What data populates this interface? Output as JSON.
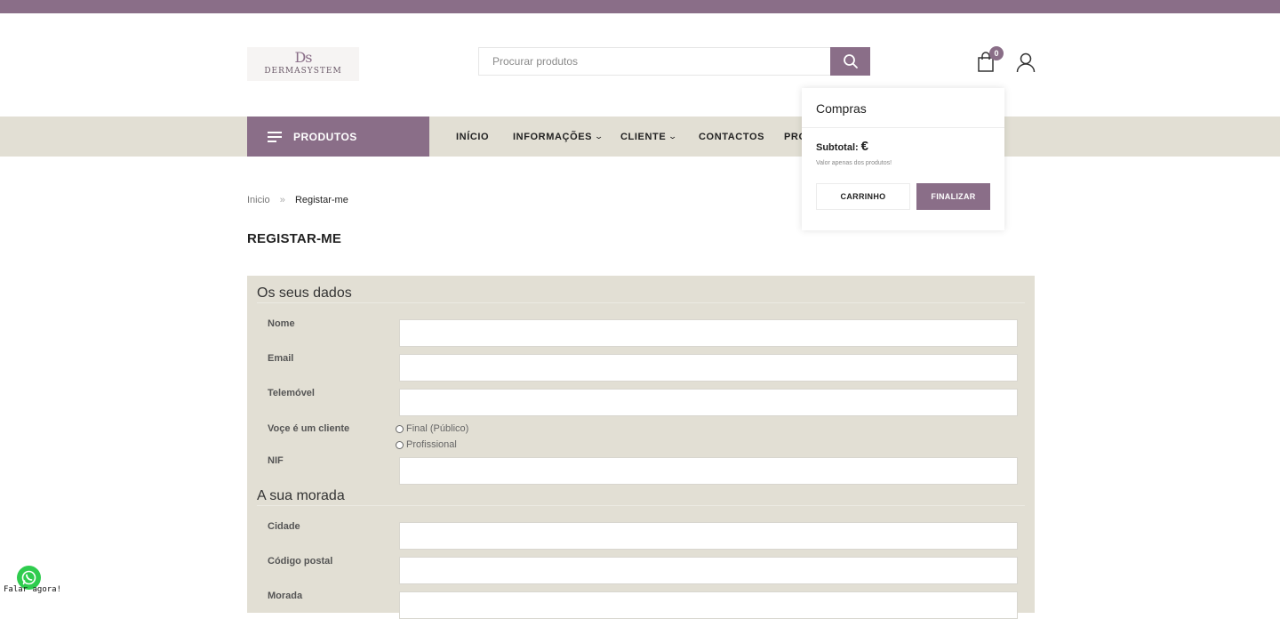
{
  "colors": {
    "brand": "#8a6e88",
    "nav_bg": "#e2dfd4",
    "whatsapp": "#2fcc4e"
  },
  "logo": {
    "mark": "Ds",
    "word": "DERMASYSTEM"
  },
  "search": {
    "placeholder": "Procurar produtos",
    "icon": "search-icon"
  },
  "header": {
    "cart_count": "0",
    "cart_icon": "shopping-bag-icon",
    "user_icon": "user-icon"
  },
  "nav": {
    "products_label": "PRODUTOS",
    "items": [
      {
        "label": "INÍCIO"
      },
      {
        "label": "INFORMAÇÕES",
        "chevron": "⌄"
      },
      {
        "label": "CLIENTE",
        "chevron": "⌄"
      },
      {
        "label": "CONTACTOS"
      },
      {
        "label": "PRO"
      }
    ]
  },
  "breadcrumb": {
    "home": "Inicio",
    "sep": "»",
    "current": "Registar-me"
  },
  "page_title": "REGISTAR-ME",
  "form": {
    "section1": "Os seus dados",
    "name": "Nome",
    "email": "Email",
    "phone": "Telemóvel",
    "client_type": "Voçe é um cliente",
    "option_final": "Final (Público)",
    "option_pro": "Profissional",
    "nif": "NIF",
    "section2": "A sua morada",
    "city": "Cidade",
    "postal": "Código postal",
    "address": "Morada"
  },
  "cart_popup": {
    "title": "Compras",
    "subtotal_label": "Subtotal:",
    "subtotal_value": "€",
    "note": "Valor apenas dos produtos!",
    "cart_button": "CARRINHO",
    "checkout_button": "FINALIZAR"
  },
  "whatsapp": {
    "label": "Falar agora!",
    "icon": "whatsapp-icon"
  }
}
